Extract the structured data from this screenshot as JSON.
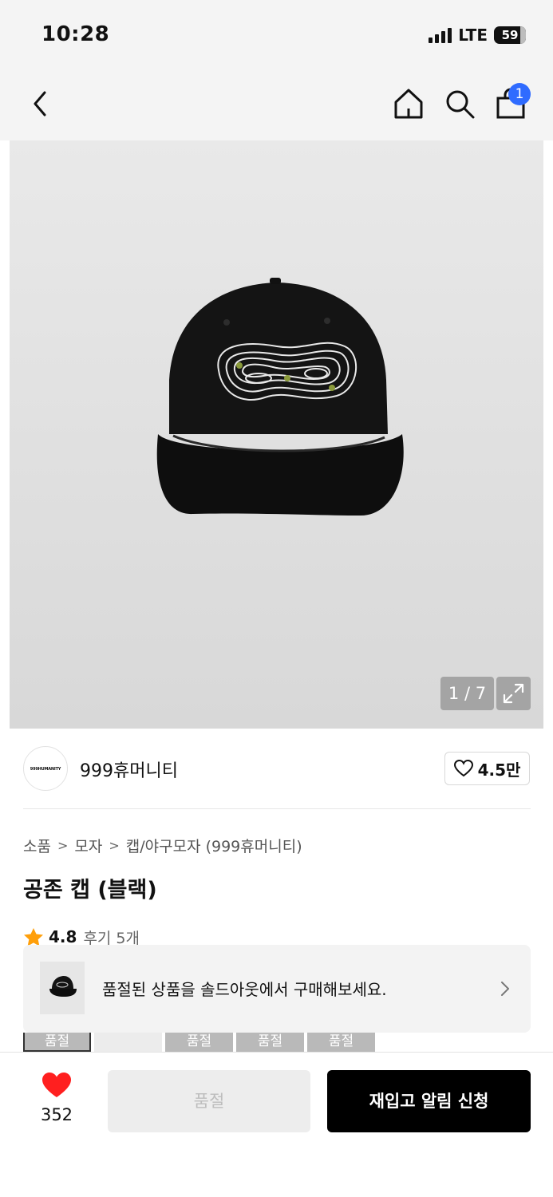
{
  "status_bar": {
    "time": "10:28",
    "network": "LTE",
    "battery": "59"
  },
  "nav": {
    "cart_badge": "1"
  },
  "gallery": {
    "counter": "1 / 7"
  },
  "brand": {
    "logo_text": "999HUMANITY",
    "name": "999휴머니티",
    "like_count": "4.5만"
  },
  "breadcrumb": [
    "소품",
    "모자",
    "캡/야구모자 (999휴머니티)"
  ],
  "product": {
    "title": "공존 캡 (블랙)",
    "rating": "4.8",
    "reviews": "후기 5개"
  },
  "soldout_banner": {
    "text": "품절된 상품을 솔드아웃에서 구매해보세요."
  },
  "options": [
    "품절",
    "",
    "품절",
    "품절",
    "품절"
  ],
  "bottom": {
    "wish_count": "352",
    "soldout_label": "품절",
    "restock_label": "재입고 알림 신청"
  },
  "colors": {
    "accent_blue": "#2f6bff",
    "heart_red": "#ff1f1f",
    "star_orange": "#ff9f0a"
  },
  "icons": [
    "back-icon",
    "home-icon",
    "search-icon",
    "cart-icon",
    "expand-icon",
    "heart-outline-icon",
    "star-icon",
    "chevron-right-icon",
    "heart-filled-icon"
  ]
}
